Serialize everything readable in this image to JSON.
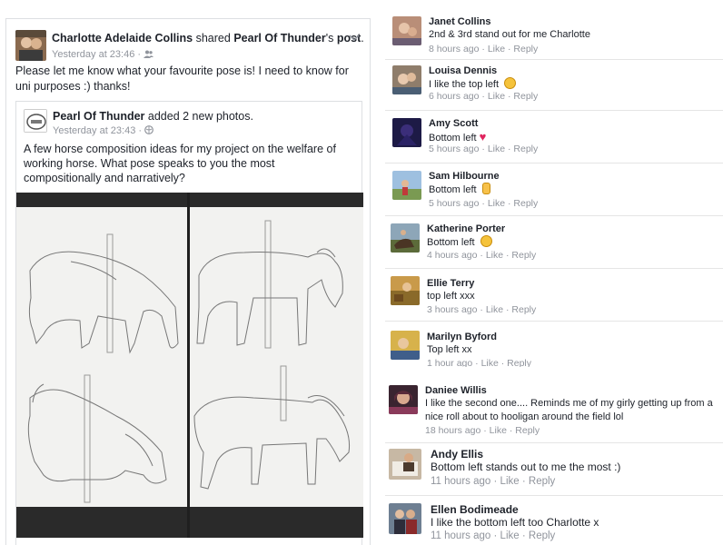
{
  "post": {
    "author": "Charlotte Adelaide Collins",
    "shared_word": "shared",
    "page_name": "Pearl Of Thunder",
    "possessive": "'s",
    "post_word": "post",
    "period": ".",
    "time": "Yesterday at 23:46",
    "privacy_icon": "friends-icon",
    "text": "Please let me know what your favourite pose is!  I need to know for uni purposes :) thanks!",
    "shared": {
      "name": "Pearl Of Thunder",
      "action": "added 2 new photos.",
      "time": "Yesterday at 23:43",
      "privacy_icon": "globe-icon",
      "text": "A few horse composition ideas for my project on the welfare of working horse. What pose speaks to you the most compositionally and narratively?"
    }
  },
  "comments": [
    {
      "name": "Janet Collins",
      "text": "2nd & 3rd stand out for me Charlotte",
      "time": "8 hours ago",
      "like": "Like",
      "reply": "Reply",
      "sep": "·"
    },
    {
      "name": "Louisa Dennis",
      "text": "I like the top left",
      "emoji": "smile-emoji",
      "time": "6 hours ago",
      "like": "Like",
      "reply": "Reply",
      "sep": "·"
    },
    {
      "name": "Amy Scott",
      "text": "Bottom left",
      "emoji": "heart-emoji",
      "time": "5 hours ago",
      "like": "Like",
      "reply": "Reply",
      "sep": "·"
    },
    {
      "name": "Sam Hilbourne",
      "text": "Bottom left",
      "emoji": "ok-hand-emoji",
      "time": "5 hours ago",
      "like": "Like",
      "reply": "Reply",
      "sep": "·"
    },
    {
      "name": "Katherine Porter",
      "text": "Bottom left",
      "emoji": "smile-emoji",
      "time": "4 hours ago",
      "like": "Like",
      "reply": "Reply",
      "sep": "·"
    },
    {
      "name": "Ellie Terry",
      "text": "top left xxx",
      "time": "3 hours ago",
      "like": "Like",
      "reply": "Reply",
      "sep": "·"
    },
    {
      "name": "Marilyn Byford",
      "text": "Top left xx",
      "time": "1 hour ago",
      "like": "Like",
      "reply": "Reply",
      "sep": "·"
    },
    {
      "name": "Daniee Willis",
      "text": "I like the second one.... Reminds me of my girly getting up from a nice roll about to hooligan around the field lol",
      "time": "18 hours ago",
      "like": "Like",
      "reply": "Reply",
      "sep": "·"
    },
    {
      "name": "Andy Ellis",
      "text": "Bottom left stands out to me the most :)",
      "time": "11 hours ago",
      "like": "Like",
      "reply": "Reply",
      "sep": "·"
    },
    {
      "name": "Ellen Bodimeade",
      "text": "I like the bottom left too Charlotte x",
      "time": "11 hours ago",
      "like": "Like",
      "reply": "Reply",
      "sep": "·"
    }
  ],
  "colors": {
    "link_blue": "#365899",
    "meta_grey": "#90949c",
    "border": "#dddfe2"
  }
}
